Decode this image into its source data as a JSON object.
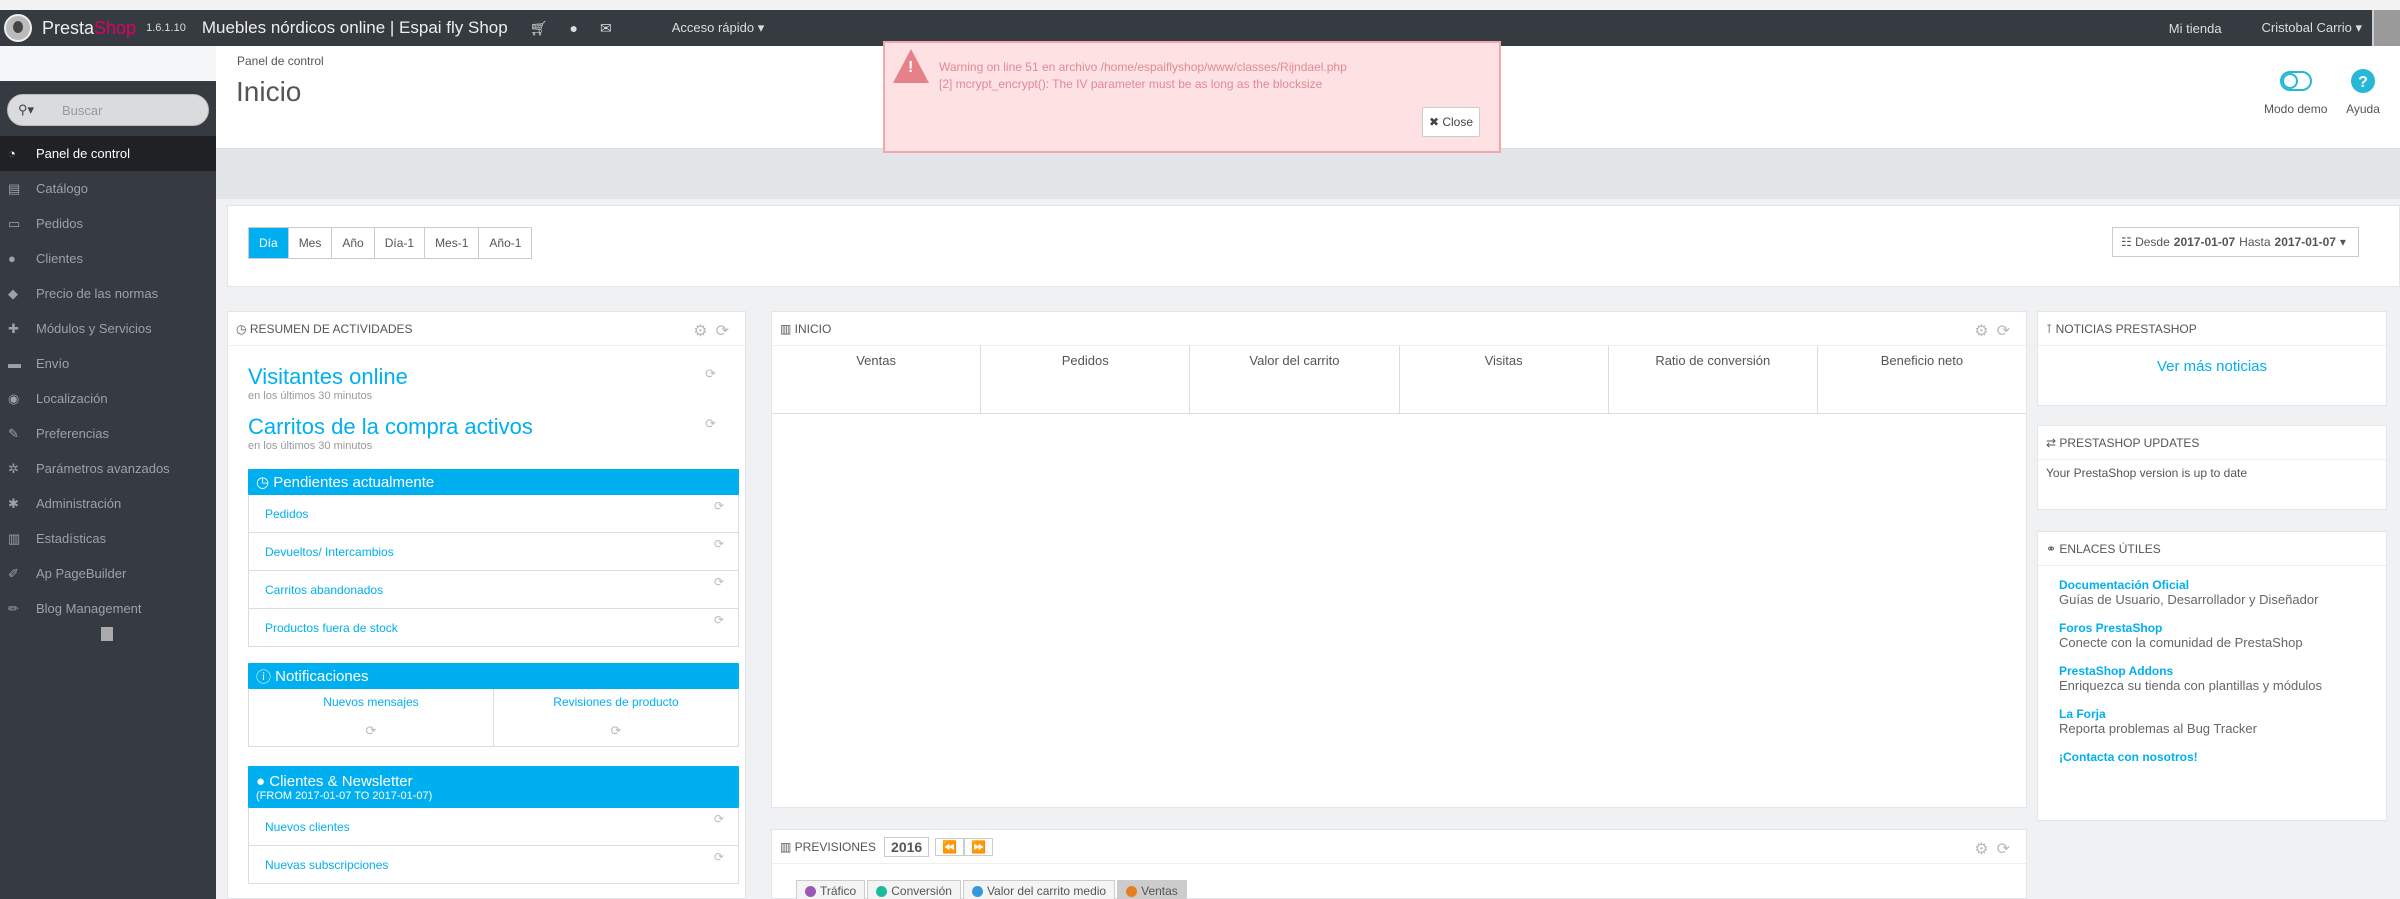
{
  "topbar": {
    "brand_a": "Presta",
    "brand_b": "Shop",
    "version": "1.6.1.10",
    "shop_name": "Muebles nórdicos online | Espai fly Shop",
    "quick_access": "Acceso rápido ▾",
    "my_shop": "Mi tienda",
    "user": "Cristobal Carrio ▾"
  },
  "sidebar": {
    "search_placeholder": "Buscar",
    "items": [
      {
        "label": "Panel de control",
        "icon": "dashboard-icon",
        "glyph": "◔"
      },
      {
        "label": "Catálogo",
        "icon": "book-icon",
        "glyph": "▤"
      },
      {
        "label": "Pedidos",
        "icon": "credit-card-icon",
        "glyph": "▭"
      },
      {
        "label": "Clientes",
        "icon": "users-icon",
        "glyph": "●"
      },
      {
        "label": "Precio de las normas",
        "icon": "tags-icon",
        "glyph": "◆"
      },
      {
        "label": "Módulos y Servicios",
        "icon": "puzzle-icon",
        "glyph": "✚"
      },
      {
        "label": "Envío",
        "icon": "truck-icon",
        "glyph": "▬"
      },
      {
        "label": "Localización",
        "icon": "globe-icon",
        "glyph": "◉"
      },
      {
        "label": "Preferencias",
        "icon": "wrench-icon",
        "glyph": "✎"
      },
      {
        "label": "Parámetros avanzados",
        "icon": "cogs-icon",
        "glyph": "✲"
      },
      {
        "label": "Administración",
        "icon": "cog-icon",
        "glyph": "✱"
      },
      {
        "label": "Estadísticas",
        "icon": "bar-chart-icon",
        "glyph": "▥"
      },
      {
        "label": "Ap PageBuilder",
        "icon": "edit-icon",
        "glyph": "✐"
      },
      {
        "label": "Blog Management",
        "icon": "pencil-icon",
        "glyph": "✏"
      }
    ]
  },
  "header": {
    "breadcrumb": "Panel de control",
    "title": "Inicio",
    "demo_mode": "Modo demo",
    "help": "Ayuda"
  },
  "alert": {
    "line1": "Warning on line 51 en archivo /home/espaiflyshop/www/classes/Rijndael.php",
    "line2": "[2] mcrypt_encrypt(): The IV parameter must be as long as the blocksize",
    "close": "Close"
  },
  "period_buttons": [
    "Día",
    "Mes",
    "Año",
    "Día-1",
    "Mes-1",
    "Año-1"
  ],
  "daterange": {
    "from_label": "Desde",
    "from": "2017-01-07",
    "to_label": "Hasta",
    "to": "2017-01-07"
  },
  "activity": {
    "title": "RESUMEN DE ACTIVIDADES",
    "visitors": "Visitantes online",
    "visitors_sub": "en los últimos 30 minutos",
    "carts": "Carritos de la compra activos",
    "carts_sub": "en los últimos 30 minutos",
    "pending_title": "Pendientes actualmente",
    "pending_items": [
      "Pedidos",
      "Devueltos/ Intercambios",
      "Carritos abandonados",
      "Productos fuera de stock"
    ],
    "notif_title": "Notificaciones",
    "notif_cols": [
      "Nuevos mensajes",
      "Revisiones de producto"
    ],
    "clients_title": "Clientes & Newsletter",
    "clients_range": "(FROM 2017-01-07 TO 2017-01-07)",
    "clients_items": [
      "Nuevos clientes",
      "Nuevas subscripciones"
    ]
  },
  "dashboard": {
    "title": "INICIO",
    "columns": [
      "Ventas",
      "Pedidos",
      "Valor del carrito",
      "Visitas",
      "Ratio de conversión",
      "Beneficio neto"
    ]
  },
  "forecast": {
    "title": "PREVISIONES",
    "year": "2016",
    "tabs": [
      {
        "label": "Tráfico",
        "color": "#9b59b6"
      },
      {
        "label": "Conversión",
        "color": "#1abc9c"
      },
      {
        "label": "Valor del carrito medio",
        "color": "#3498db"
      },
      {
        "label": "Ventas",
        "color": "#e67e22"
      }
    ]
  },
  "news": {
    "title": "NOTICIAS PRESTASHOP",
    "more": "Ver más noticias"
  },
  "updates": {
    "title": "PRESTASHOP UPDATES",
    "text": "Your PrestaShop version is up to date"
  },
  "links": {
    "title": "ENLACES ÚTILES",
    "items": [
      {
        "title": "Documentación Oficial",
        "desc": "Guías de Usuario, Desarrollador y Diseñador"
      },
      {
        "title": "Foros PrestaShop",
        "desc": "Conecte con la comunidad de PrestaShop"
      },
      {
        "title": "PrestaShop Addons",
        "desc": "Enriquezca su tienda con plantillas y módulos"
      },
      {
        "title": "La Forja",
        "desc": "Reporta problemas al Bug Tracker"
      }
    ],
    "contact": "¡Contacta con nosotros!"
  }
}
